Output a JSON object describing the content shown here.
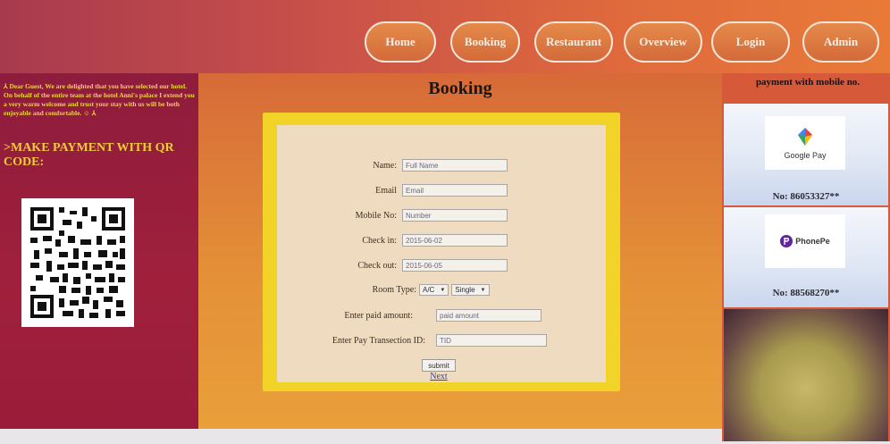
{
  "nav": {
    "items": [
      "Home",
      "Booking",
      "Restaurant",
      "Overview",
      "Login",
      "Admin"
    ]
  },
  "left": {
    "welcome": "⅄ Dear Guest, We are delighted that you have selected our hotel. On behalf of the entire team at the hotel Anni's palace I extend you a very warm welcome and trust your stay with us will be both enjoyable and comfortable. ☺ ⅄",
    "qr_heading": ">MAKE PAYMENT WITH QR CODE:"
  },
  "booking": {
    "title": "Booking",
    "fields": {
      "name_label": "Name:",
      "name_placeholder": "Full Name",
      "email_label": "Email",
      "email_placeholder": "Email",
      "mobile_label": "Mobile No:",
      "mobile_placeholder": "Number",
      "checkin_label": "Check in:",
      "checkin_value": "2015-06-02",
      "checkout_label": "Check out:",
      "checkout_value": "2015-06-05",
      "roomtype_label": "Room Type:",
      "roomtype_ac": "A/C",
      "roomtype_bed": "Single",
      "amount_label": "Enter paid amount:",
      "amount_placeholder": "paid amount",
      "tid_label": "Enter Pay Transection ID:",
      "tid_placeholder": "TID"
    },
    "submit_label": "submit",
    "next_label": "Next"
  },
  "right": {
    "heading": "payment with mobile no.",
    "gpay_brand": "Google Pay",
    "gpay_no": "No: 86053327**",
    "phonepe_brand": "PhonePe",
    "phonepe_no": "No: 88568270**"
  },
  "colors": {
    "header_accent": "#c8504a",
    "left_panel": "#9a1c3a",
    "form_frame": "#f2d328",
    "highlight_text": "#f2cc3c"
  }
}
